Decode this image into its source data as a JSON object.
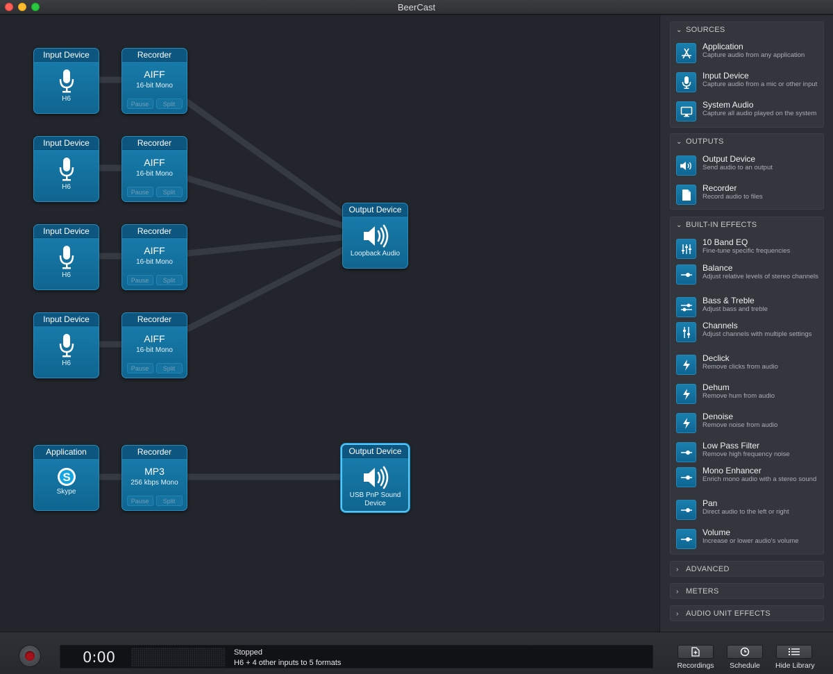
{
  "window": {
    "title": "BeerCast"
  },
  "canvas": {
    "rows": [
      {
        "input": {
          "header": "Input Device",
          "name": "H6",
          "icon": "microphone-icon"
        },
        "recorder": {
          "header": "Recorder",
          "format": "AIFF",
          "detail": "16-bit Mono",
          "pause": "Pause",
          "split": "Split"
        }
      },
      {
        "input": {
          "header": "Input Device",
          "name": "H6",
          "icon": "microphone-icon"
        },
        "recorder": {
          "header": "Recorder",
          "format": "AIFF",
          "detail": "16-bit Mono",
          "pause": "Pause",
          "split": "Split"
        }
      },
      {
        "input": {
          "header": "Input Device",
          "name": "H6",
          "icon": "microphone-icon"
        },
        "recorder": {
          "header": "Recorder",
          "format": "AIFF",
          "detail": "16-bit Mono",
          "pause": "Pause",
          "split": "Split"
        }
      },
      {
        "input": {
          "header": "Input Device",
          "name": "H6",
          "icon": "microphone-icon"
        },
        "recorder": {
          "header": "Recorder",
          "format": "AIFF",
          "detail": "16-bit Mono",
          "pause": "Pause",
          "split": "Split"
        }
      },
      {
        "input": {
          "header": "Application",
          "name": "Skype",
          "icon": "skype-icon"
        },
        "recorder": {
          "header": "Recorder",
          "format": "MP3",
          "detail": "256 kbps Mono",
          "pause": "Pause",
          "split": "Split"
        }
      }
    ],
    "outputs": [
      {
        "header": "Output Device",
        "name": "Loopback Audio",
        "icon": "speaker-icon"
      },
      {
        "header": "Output Device",
        "name": "USB PnP Sound Device",
        "icon": "speaker-icon"
      }
    ]
  },
  "sidebar": {
    "sources": {
      "title": "SOURCES",
      "items": [
        {
          "name": "Application",
          "desc": "Capture audio from any application",
          "icon": "app-store-icon"
        },
        {
          "name": "Input Device",
          "desc": "Capture audio from a mic or other input",
          "icon": "microphone-icon"
        },
        {
          "name": "System Audio",
          "desc": "Capture all audio played on the system",
          "icon": "monitor-icon"
        }
      ]
    },
    "outputs": {
      "title": "OUTPUTS",
      "items": [
        {
          "name": "Output Device",
          "desc": "Send audio to an output",
          "icon": "speaker-icon"
        },
        {
          "name": "Recorder",
          "desc": "Record audio to files",
          "icon": "document-icon"
        }
      ]
    },
    "effects": {
      "title": "BUILT-IN EFFECTS",
      "items": [
        {
          "name": "10 Band EQ",
          "desc": "Fine-tune specific frequencies",
          "icon": "eq-icon"
        },
        {
          "name": "Balance",
          "desc": "Adjust relative levels of stereo channels",
          "icon": "slider-icon"
        },
        {
          "name": "Bass & Treble",
          "desc": "Adjust bass and treble",
          "icon": "bass-treble-icon"
        },
        {
          "name": "Channels",
          "desc": "Adjust channels with multiple settings",
          "icon": "channels-icon"
        },
        {
          "name": "Declick",
          "desc": "Remove clicks from audio",
          "icon": "lightning-icon"
        },
        {
          "name": "Dehum",
          "desc": "Remove hum from audio",
          "icon": "lightning-icon"
        },
        {
          "name": "Denoise",
          "desc": "Remove noise from audio",
          "icon": "lightning-icon"
        },
        {
          "name": "Low Pass Filter",
          "desc": "Remove high frequency noise",
          "icon": "slider-icon"
        },
        {
          "name": "Mono Enhancer",
          "desc": "Enrich mono audio with a stereo sound",
          "icon": "slider-icon"
        },
        {
          "name": "Pan",
          "desc": "Direct audio to the left or right",
          "icon": "slider-icon"
        },
        {
          "name": "Volume",
          "desc": "Increase or lower audio's volume",
          "icon": "slider-icon"
        }
      ]
    },
    "collapsed": [
      "ADVANCED",
      "METERS",
      "AUDIO UNIT EFFECTS"
    ]
  },
  "bottom": {
    "time": "0:00",
    "status": "Stopped",
    "detail": "H6 + 4 other inputs to 5 formats",
    "buttons": {
      "recordings": "Recordings",
      "schedule": "Schedule",
      "hide_library": "Hide Library"
    }
  },
  "colors": {
    "accent": "#1577a7",
    "selected": "#58c6f5",
    "record": "#a3121a"
  }
}
